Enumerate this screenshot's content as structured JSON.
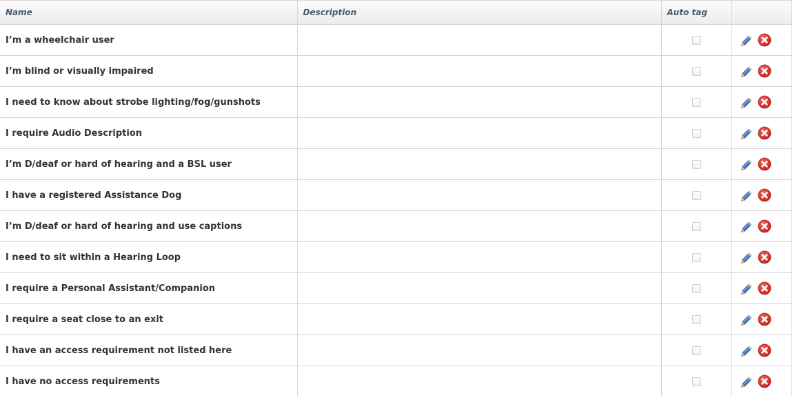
{
  "table": {
    "columns": {
      "name": "Name",
      "description": "Description",
      "auto_tag": "Auto tag",
      "actions": ""
    },
    "rows": [
      {
        "name": "I’m a wheelchair user",
        "description": "",
        "auto_tag": false
      },
      {
        "name": "I’m blind or visually impaired",
        "description": "",
        "auto_tag": false
      },
      {
        "name": "I need to know about strobe lighting/fog/gunshots",
        "description": "",
        "auto_tag": false
      },
      {
        "name": "I require Audio Description",
        "description": "",
        "auto_tag": false
      },
      {
        "name": "I’m D/deaf or hard of hearing and a BSL user",
        "description": "",
        "auto_tag": false
      },
      {
        "name": "I have a registered Assistance Dog",
        "description": "",
        "auto_tag": false
      },
      {
        "name": "I’m D/deaf or hard of hearing and use captions",
        "description": "",
        "auto_tag": false
      },
      {
        "name": "I need to sit within a Hearing Loop",
        "description": "",
        "auto_tag": false
      },
      {
        "name": "I require a Personal Assistant/Companion",
        "description": "",
        "auto_tag": false
      },
      {
        "name": "I require a seat close to an exit",
        "description": "",
        "auto_tag": false
      },
      {
        "name": "I have an access requirement not listed here",
        "description": "",
        "auto_tag": false
      },
      {
        "name": "I have no access requirements",
        "description": "",
        "auto_tag": false
      }
    ],
    "row_actions": [
      {
        "icon": "pencil-icon",
        "action": "edit"
      },
      {
        "icon": "delete-x-icon",
        "action": "delete"
      }
    ]
  },
  "colors": {
    "header_text": "#4a5a6a",
    "delete_red": "#d9302c",
    "pencil_blue": "#3f7ac1",
    "border": "#d6d6d6"
  }
}
